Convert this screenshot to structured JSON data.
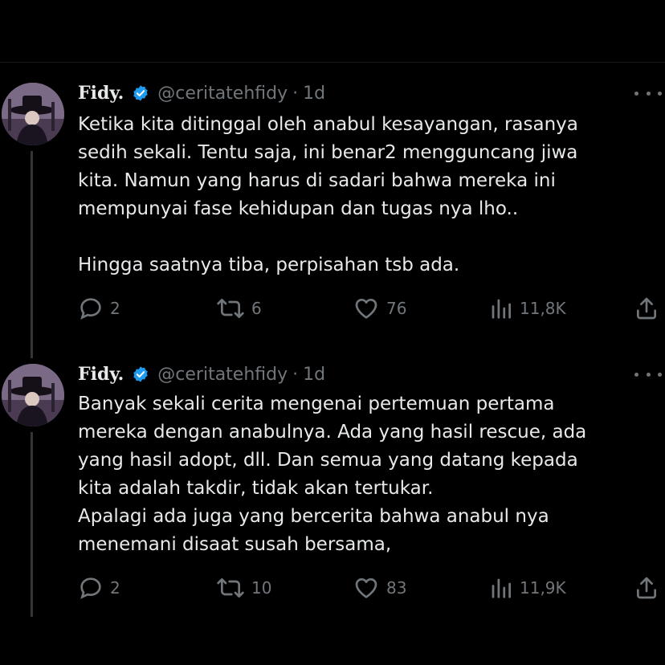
{
  "tweets": [
    {
      "author": {
        "name": "Fidy.",
        "handle": "@ceritatehfidy",
        "time": "1d"
      },
      "text": "Ketika kita ditinggal oleh anabul kesayangan, rasanya\nsedih sekali. Tentu saja, ini benar2 mengguncang jiwa\nkita. Namun yang harus di sadari bahwa mereka ini\nmempunyai fase kehidupan dan tugas nya lho..\n\nHingga saatnya tiba, perpisahan tsb ada.",
      "replies": "2",
      "reposts": "6",
      "likes": "76",
      "views": "11,8K"
    },
    {
      "author": {
        "name": "Fidy.",
        "handle": "@ceritatehfidy",
        "time": "1d"
      },
      "text": "Banyak sekali cerita mengenai pertemuan pertama\nmereka dengan anabulnya. Ada yang hasil rescue, ada\nyang hasil adopt, dll. Dan semua yang datang kepada\nkita adalah takdir, tidak akan tertukar.\nApalagi ada juga yang bercerita bahwa anabul nya\nmenemani disaat susah bersama,",
      "replies": "2",
      "reposts": "10",
      "likes": "83",
      "views": "11,9K"
    }
  ],
  "separator": "·",
  "colors": {
    "background": "#000000",
    "text": "#e7e9ea",
    "muted": "#71767b",
    "verified": "#1d9bf0",
    "thread_line": "#333639"
  },
  "icons": [
    "verified-badge-icon",
    "more-options-icon",
    "reply-icon",
    "repost-icon",
    "like-icon",
    "views-icon",
    "share-icon"
  ]
}
